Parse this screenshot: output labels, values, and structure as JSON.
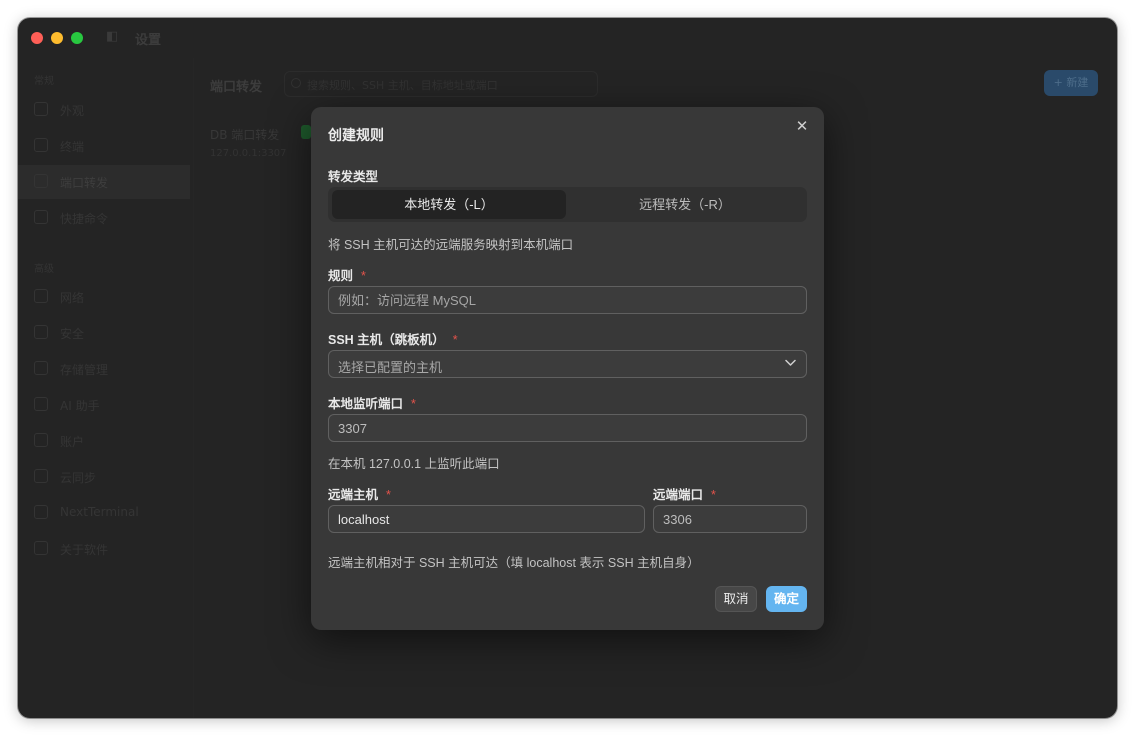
{
  "window": {
    "title": "设置"
  },
  "sidebar": {
    "section1": "常规",
    "section2": "高级",
    "items": [
      {
        "label": "外观",
        "icon": "brush-icon"
      },
      {
        "label": "终端",
        "icon": "terminal-icon"
      },
      {
        "label": "端口转发",
        "icon": "forward-icon"
      },
      {
        "label": "快捷命令",
        "icon": "command-icon"
      },
      {
        "label": "网络",
        "icon": "network-icon"
      },
      {
        "label": "安全",
        "icon": "shield-icon"
      },
      {
        "label": "存储管理",
        "icon": "storage-icon"
      },
      {
        "label": "AI 助手",
        "icon": "ai-icon"
      },
      {
        "label": "账户",
        "icon": "user-icon"
      },
      {
        "label": "云同步",
        "icon": "cloud-icon"
      },
      {
        "label": "NextTerminal",
        "icon": "server-icon"
      },
      {
        "label": "关于软件",
        "icon": "info-icon"
      }
    ]
  },
  "content": {
    "title": "端口转发",
    "search_placeholder": "搜索规则、SSH 主机、目标地址或端口",
    "new_label": "+ 新建",
    "rule_name": "DB 端口转发",
    "rule_meta": "127.0.0.1:3307"
  },
  "modal": {
    "title": "创建规则",
    "type_label": "转发类型",
    "type_options": {
      "local": "本地转发（-L）",
      "remote": "远程转发（-R）"
    },
    "type_hint": "将 SSH 主机可达的远端服务映射到本机端口",
    "rule_label": "规则",
    "rule_placeholder": "例如：访问远程 MySQL",
    "ssh_label": "SSH 主机（跳板机）",
    "ssh_placeholder": "选择已配置的主机",
    "local_port_label": "本地监听端口",
    "local_port_value": "3307",
    "local_port_hint": "在本机 127.0.0.1 上监听此端口",
    "remote_host_label": "远端主机",
    "remote_host_value": "localhost",
    "remote_port_label": "远端端口",
    "remote_port_value": "3306",
    "remote_hint": "远端主机相对于 SSH 主机可达（填 localhost 表示 SSH 主机自身）",
    "required_mark": "*",
    "cancel_label": "取消",
    "ok_label": "确定",
    "accent_color": "#64b5f0",
    "required_color": "#e5534b"
  }
}
